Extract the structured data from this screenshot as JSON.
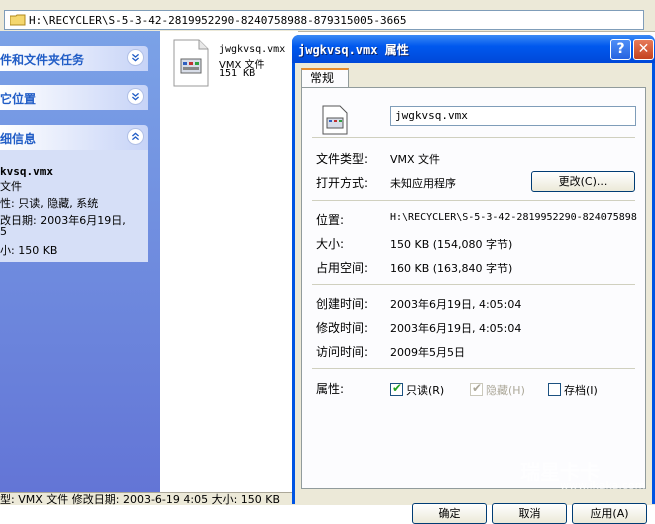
{
  "address": {
    "path": "H:\\RECYCLER\\S-5-3-42-2819952290-8240758988-879315005-3665"
  },
  "sidebar": {
    "tasks_title": "件和文件夹任务",
    "places_title": "它位置",
    "details_title": "细信息",
    "details": {
      "filename": "kvsq.vmx",
      "type": "文件",
      "attributes": "性: 只读, 隐藏, 系统",
      "modified": "改日期: 2003年6月19日,",
      "modified_cont": "5",
      "size": "小: 150 KB"
    }
  },
  "file": {
    "name": "jwgkvsq.vmx",
    "type": "VMX 文件",
    "size": "151 KB"
  },
  "status": {
    "text": "型: VMX 文件 修改日期: 2003-6-19 4:05 大小: 150 KB"
  },
  "dialog": {
    "title": "jwgkvsq.vmx 属性",
    "help": "?",
    "close": "✕",
    "tab": "常规",
    "filename": "jwgkvsq.vmx",
    "type_label": "文件类型:",
    "type_value": "VMX 文件",
    "open_label": "打开方式:",
    "open_value": "未知应用程序",
    "change_button": "更改(C)...",
    "location_label": "位置:",
    "location_value": "H:\\RECYCLER\\S-5-3-42-2819952290-824075898",
    "size_label": "大小:",
    "size_value": "150 KB (154,080 字节)",
    "disk_label": "占用空间:",
    "disk_value": "160 KB (163,840 字节)",
    "created_label": "创建时间:",
    "created_value": "2003年6月19日, 4:05:04",
    "modified_label": "修改时间:",
    "modified_value": "2003年6月19日, 4:05:04",
    "accessed_label": "访问时间:",
    "accessed_value": "2009年5月5日",
    "attr_label": "属性:",
    "readonly": "只读(R)",
    "hidden": "隐藏(H)",
    "archive": "存档(I)",
    "ok": "确定",
    "cancel": "取消",
    "apply": "应用(A)"
  },
  "watermark": {
    "line1": "瑞星卡卡",
    "line2": "www.ikaka.com"
  }
}
